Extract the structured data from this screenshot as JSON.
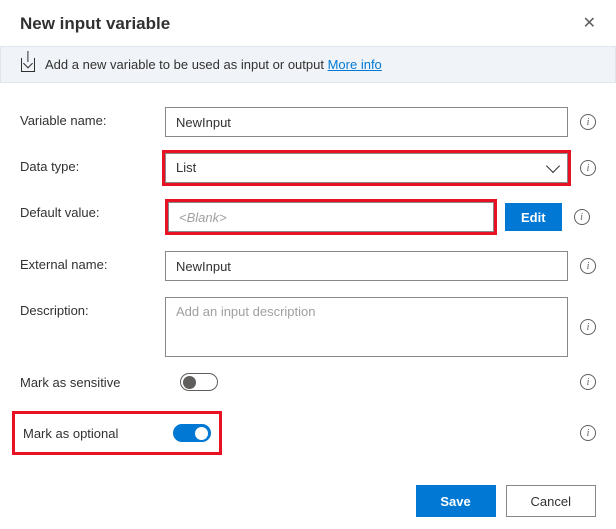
{
  "dialog": {
    "title": "New input variable",
    "info_text": "Add a new variable to be used as input or output",
    "more_info": "More info"
  },
  "fields": {
    "variable_name": {
      "label": "Variable name:",
      "value": "NewInput"
    },
    "data_type": {
      "label": "Data type:",
      "value": "List"
    },
    "default_value": {
      "label": "Default value:",
      "value": "<Blank>",
      "edit_label": "Edit"
    },
    "external_name": {
      "label": "External name:",
      "value": "NewInput"
    },
    "description": {
      "label": "Description:",
      "placeholder": "Add an input description"
    },
    "mark_sensitive": {
      "label": "Mark as sensitive",
      "on": false
    },
    "mark_optional": {
      "label": "Mark as optional",
      "on": true
    }
  },
  "footer": {
    "save": "Save",
    "cancel": "Cancel"
  }
}
